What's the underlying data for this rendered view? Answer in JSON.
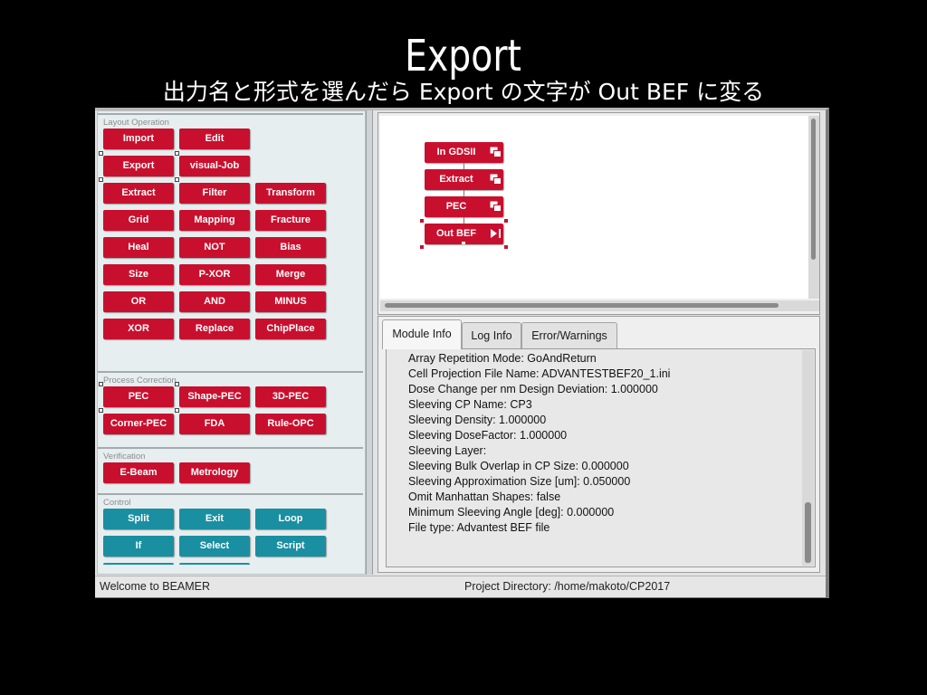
{
  "slide": {
    "title": "Export",
    "subtitle": "出力名と形式を選んだら Export の文字が Out BEF に変る"
  },
  "left_panel": {
    "sections": [
      {
        "label": "Layout Operation",
        "button_color": "#c8102e",
        "rows": [
          [
            "Import",
            "Edit"
          ],
          [
            "Export",
            "visual-Job"
          ],
          [
            "Extract",
            "Filter",
            "Transform"
          ],
          [
            "Grid",
            "Mapping",
            "Fracture"
          ],
          [
            "Heal",
            "NOT",
            "Bias"
          ],
          [
            "Size",
            "P-XOR",
            "Merge"
          ],
          [
            "OR",
            "AND",
            "MINUS"
          ],
          [
            "XOR",
            "Replace",
            "ChipPlace"
          ]
        ]
      },
      {
        "label": "Process Correction",
        "button_color": "#c8102e",
        "rows": [
          [
            "PEC",
            "Shape-PEC",
            "3D-PEC"
          ],
          [
            "Corner-PEC",
            "FDA",
            "Rule-OPC"
          ]
        ]
      },
      {
        "label": "Verification",
        "button_color": "#c8102e",
        "rows": [
          [
            "E-Beam",
            "Metrology"
          ]
        ]
      },
      {
        "label": "Control",
        "button_color": "#1a8fa1",
        "rows": [
          [
            "Split",
            "Exit",
            "Loop"
          ],
          [
            "If",
            "Select",
            "Script"
          ]
        ]
      }
    ]
  },
  "workflow": {
    "nodes": [
      {
        "label": "In GDSII",
        "icon": "module-copy-icon"
      },
      {
        "label": "Extract",
        "icon": "module-copy-icon"
      },
      {
        "label": "PEC",
        "icon": "module-copy-icon"
      },
      {
        "label": "Out BEF",
        "icon": "skip-to-end-icon",
        "selected": true
      }
    ]
  },
  "info_panel": {
    "tabs": [
      {
        "label": "Module Info",
        "active": true
      },
      {
        "label": "Log Info",
        "active": false
      },
      {
        "label": "Error/Warnings",
        "active": false
      }
    ],
    "lines": [
      "Array Repetition Mode: GoAndReturn",
      "Cell Projection File Name: ADVANTESTBEF20_1.ini",
      "Dose Change per nm Design Deviation: 1.000000",
      "Sleeving CP Name: CP3",
      "Sleeving Density: 1.000000",
      "Sleeving DoseFactor: 1.000000",
      "Sleeving Layer:",
      "Sleeving Bulk Overlap in CP Size: 0.000000",
      "Sleeving Approximation Size [um]: 0.050000",
      "Omit Manhattan Shapes: false",
      "Minimum Sleeving Angle [deg]: 0.000000",
      "File type: Advantest BEF file"
    ]
  },
  "status_bar": {
    "message": "Welcome to BEAMER",
    "project_directory": "Project Directory: /home/makoto/CP2017"
  }
}
